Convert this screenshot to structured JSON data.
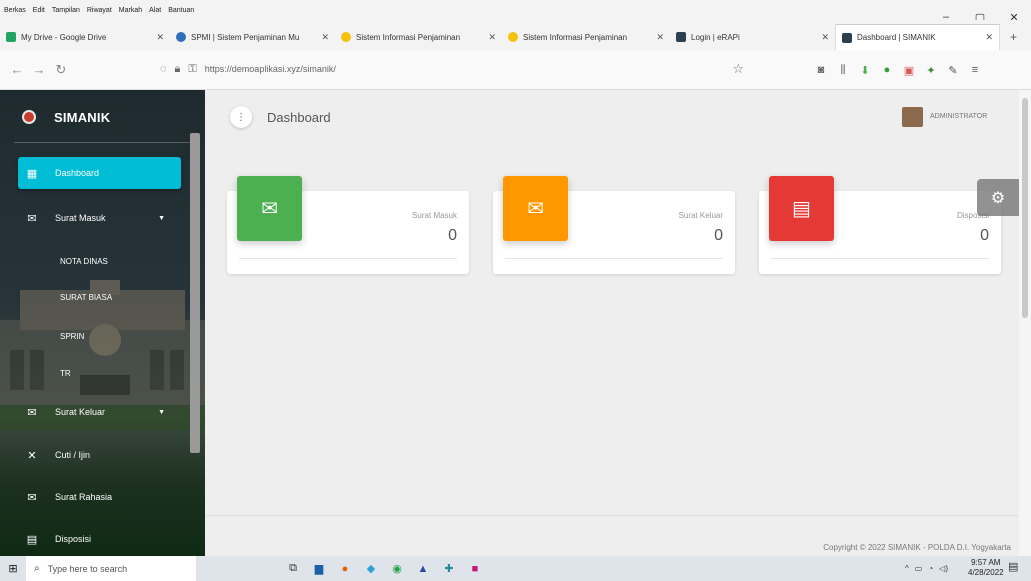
{
  "menubar": {
    "items": [
      "Berkas",
      "Edit",
      "Tampilan",
      "Riwayat",
      "Markah",
      "Alat",
      "Bantuan"
    ],
    "window_controls": [
      "–",
      "▢",
      "✕"
    ]
  },
  "tabs": [
    {
      "title": "My Drive - Google Drive",
      "color": "#1fa463",
      "active": false
    },
    {
      "title": "SPMI | Sistem Penjaminan Mu",
      "color": "#2f6fba",
      "active": false
    },
    {
      "title": "Sistem Informasi Penjaminan",
      "color": "#f4c20d",
      "active": false
    },
    {
      "title": "Sistem Informasi Penjaminan",
      "color": "#f4c20d",
      "active": false
    },
    {
      "title": "Login | eRAPi",
      "color": "#2d3e50",
      "active": false
    },
    {
      "title": "Dashboard | SIMANIK",
      "color": "#2d3e50",
      "active": true
    }
  ],
  "navbar": {
    "url": "https://demoaplikasi.xyz/simanik/"
  },
  "sidebar": {
    "brand": "SIMANIK",
    "items": [
      {
        "label": "Dashboard",
        "icon": "dashboard-icon",
        "active": true
      },
      {
        "label": "Surat Masuk",
        "icon": "mail-in-icon",
        "active": false,
        "caret": true
      },
      {
        "label": "Surat Keluar",
        "icon": "mail-out-icon",
        "active": false,
        "caret": true
      },
      {
        "label": "Cuti / Ijin",
        "icon": "leave-icon",
        "active": false
      },
      {
        "label": "Surat Rahasia",
        "icon": "secret-mail-icon",
        "active": false
      },
      {
        "label": "Disposisi",
        "icon": "disposition-icon",
        "active": false
      }
    ],
    "submenu": [
      "NOTA DINAS",
      "SURAT BIASA",
      "SPRIN",
      "TR"
    ]
  },
  "header": {
    "title": "Dashboard",
    "user": "ADMINISTRATOR"
  },
  "cards": [
    {
      "label": "Surat Masuk",
      "value": "0",
      "color": "#4caf50",
      "icon": "mail-check-icon"
    },
    {
      "label": "Surat Keluar",
      "value": "0",
      "color": "#ff9800",
      "icon": "mail-send-icon"
    },
    {
      "label": "Disposisi",
      "value": "0",
      "color": "#e53935",
      "icon": "id-card-icon"
    }
  ],
  "footer": {
    "copyright": "Copyright © 2022 SIMANIK - POLDA D.I. Yogyakarta"
  },
  "taskbar": {
    "search_placeholder": "Type here to search",
    "time": "9:57 AM",
    "date": "4/28/2022"
  }
}
